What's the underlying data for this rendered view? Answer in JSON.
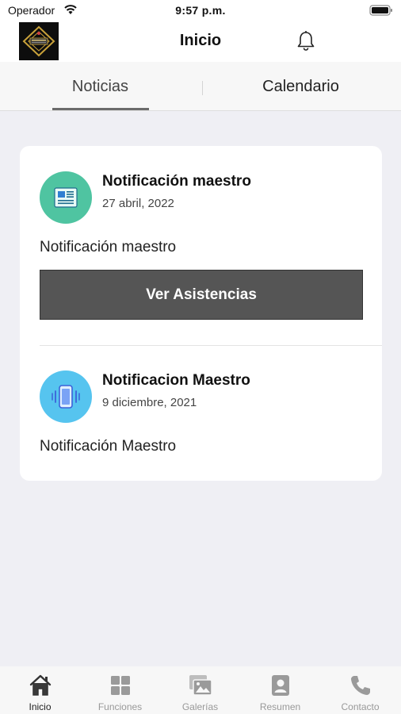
{
  "status": {
    "carrier": "Operador",
    "time": "9:57 p.m."
  },
  "header": {
    "title": "Inicio",
    "logo_icon": "school-logo",
    "notification_icon": "bell-icon"
  },
  "tabs": [
    {
      "label": "Noticias",
      "selected": true
    },
    {
      "label": "Calendario",
      "selected": false
    }
  ],
  "news": [
    {
      "title": "Notificación maestro",
      "date": "27 abril, 2022",
      "body": "Notificación maestro",
      "icon": "newspaper-icon",
      "icon_color": "#4fc4a1",
      "button_label": "Ver Asistencias"
    },
    {
      "title": "Notificacion Maestro",
      "date": "9 diciembre, 2021",
      "body": "Notificación Maestro",
      "icon": "phone-vibrate-icon",
      "icon_color": "#56c4ef"
    }
  ],
  "bottom_nav": [
    {
      "label": "Inicio",
      "icon": "home-icon",
      "active": true
    },
    {
      "label": "Funciones",
      "icon": "grid-icon",
      "active": false
    },
    {
      "label": "Galerías",
      "icon": "gallery-icon",
      "active": false
    },
    {
      "label": "Resumen",
      "icon": "profile-card-icon",
      "active": false
    },
    {
      "label": "Contacto",
      "icon": "phone-icon",
      "active": false
    }
  ]
}
